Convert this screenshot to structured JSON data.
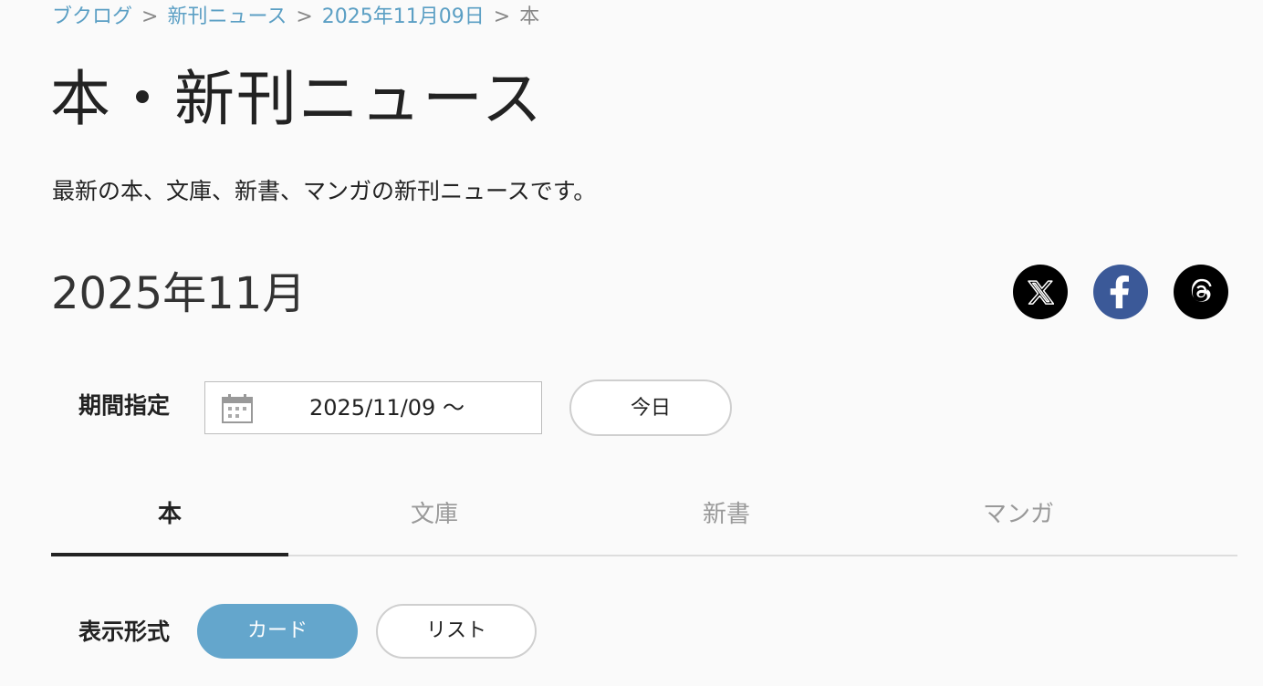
{
  "breadcrumb": {
    "items": [
      "ブクログ",
      "新刊ニュース",
      "2025年11月09日"
    ],
    "current": "本",
    "separator": ">"
  },
  "page": {
    "title": "本・新刊ニュース",
    "description": "最新の本、文庫、新書、マンガの新刊ニュースです。"
  },
  "month_heading": "2025年11月",
  "share": {
    "icons": [
      "x-icon",
      "facebook-icon",
      "threads-icon"
    ]
  },
  "period": {
    "label": "期間指定",
    "date_value": "2025/11/09 〜",
    "today_label": "今日"
  },
  "tabs": [
    {
      "label": "本",
      "active": true
    },
    {
      "label": "文庫",
      "active": false
    },
    {
      "label": "新書",
      "active": false
    },
    {
      "label": "マンガ",
      "active": false
    }
  ],
  "display_format": {
    "label": "表示形式",
    "options": [
      "カード",
      "リスト"
    ],
    "selected": "カード"
  },
  "colors": {
    "link": "#5b9fc4",
    "accent": "#64a6cc",
    "facebook": "#3b5998"
  }
}
